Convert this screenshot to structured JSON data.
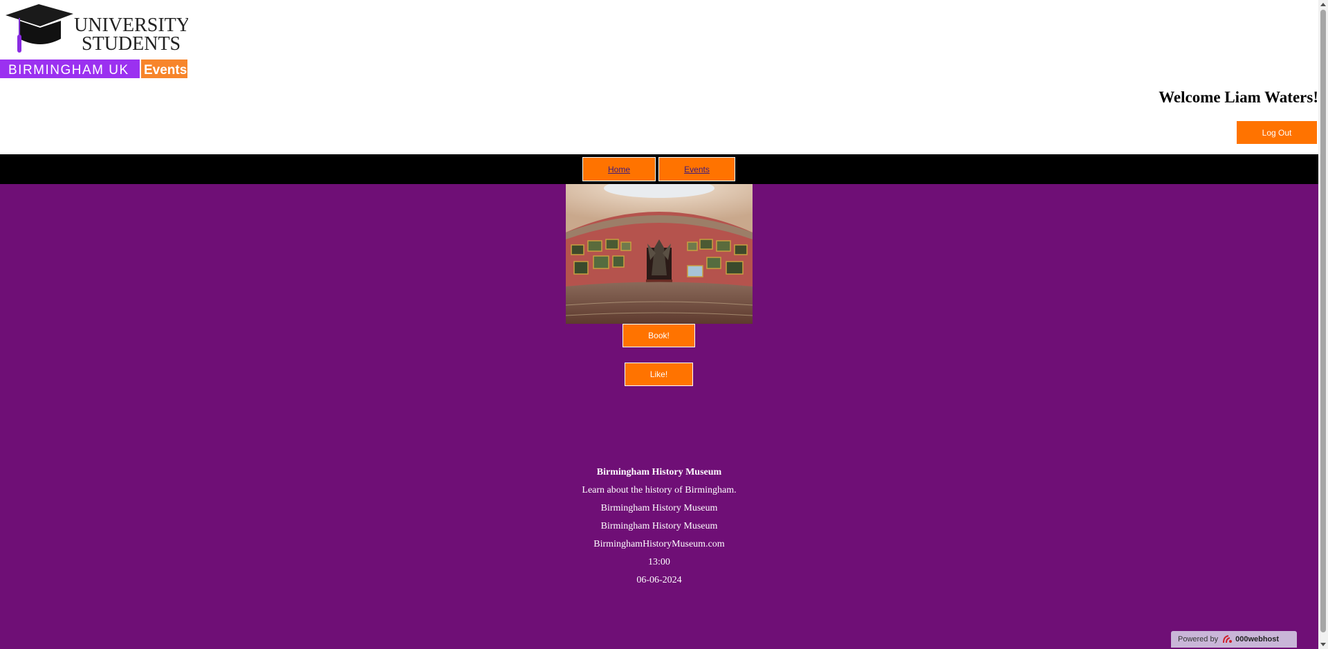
{
  "logo": {
    "line1": "UNIVERSITY",
    "line2": "STUDENTS",
    "city": "BIRMINGHAM UK",
    "tag": "Events",
    "colors": {
      "purple": "#9b31f0",
      "orange": "#f7852b"
    }
  },
  "header": {
    "welcome": "Welcome Liam Waters!",
    "logout_label": "Log Out"
  },
  "nav": {
    "items": [
      {
        "label": "Home"
      },
      {
        "label": "Events"
      }
    ]
  },
  "event": {
    "image_alt": "museum-rotunda-gallery-photo",
    "book_label": "Book!",
    "like_label": "Like!",
    "name": "Birmingham History Museum",
    "description": "Learn about the history of Birmingham.",
    "venue": "Birmingham History Museum",
    "organiser": "Birmingham History Museum",
    "website": "BirminghamHistoryMuseum.com",
    "time": "13:00",
    "date": "06-06-2024"
  },
  "footer_badge": {
    "prefix": "Powered by",
    "brand": "000webhost"
  },
  "colors": {
    "page_background": "#6f0f76",
    "button": "#ff7300",
    "navbar": "#000000"
  }
}
